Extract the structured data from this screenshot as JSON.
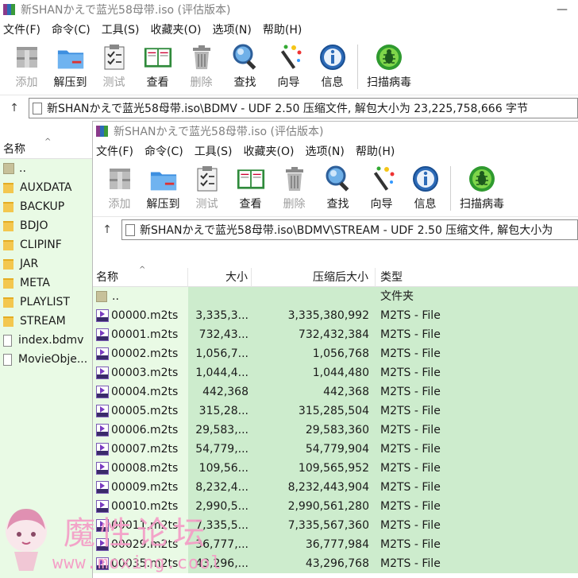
{
  "window1": {
    "title": "新SHANかえで蓝光58母带.iso (评估版本)",
    "menu": [
      "文件(F)",
      "命令(C)",
      "工具(S)",
      "收藏夹(O)",
      "选项(N)",
      "帮助(H)"
    ],
    "toolbar": {
      "add": "添加",
      "extract": "解压到",
      "test": "测试",
      "view": "查看",
      "delete": "删除",
      "find": "查找",
      "wizard": "向导",
      "info": "信息",
      "scan": "扫描病毒"
    },
    "address": "新SHANかえで蓝光58母带.iso\\BDMV - UDF 2.50 压缩文件, 解包大小为 23,225,758,666 字节",
    "column_name": "名称",
    "items": [
      {
        "name": "..",
        "kind": "parent"
      },
      {
        "name": "AUXDATA",
        "kind": "folder"
      },
      {
        "name": "BACKUP",
        "kind": "folder"
      },
      {
        "name": "BDJO",
        "kind": "folder"
      },
      {
        "name": "CLIPINF",
        "kind": "folder"
      },
      {
        "name": "JAR",
        "kind": "folder"
      },
      {
        "name": "META",
        "kind": "folder"
      },
      {
        "name": "PLAYLIST",
        "kind": "folder"
      },
      {
        "name": "STREAM",
        "kind": "folder"
      },
      {
        "name": "index.bdmv",
        "kind": "file"
      },
      {
        "name": "MovieObje...",
        "kind": "file"
      }
    ]
  },
  "window2": {
    "title": "新SHANかえで蓝光58母带.iso (评估版本)",
    "menu": [
      "文件(F)",
      "命令(C)",
      "工具(S)",
      "收藏夹(O)",
      "选项(N)",
      "帮助(H)"
    ],
    "toolbar": {
      "add": "添加",
      "extract": "解压到",
      "test": "测试",
      "view": "查看",
      "delete": "删除",
      "find": "查找",
      "wizard": "向导",
      "info": "信息",
      "scan": "扫描病毒"
    },
    "address": "新SHANかえで蓝光58母带.iso\\BDMV\\STREAM - UDF 2.50 压缩文件, 解包大小为",
    "columns": {
      "name": "名称",
      "size": "大小",
      "packed": "压缩后大小",
      "type": "类型"
    },
    "parent": {
      "name": "..",
      "type": "文件夹"
    },
    "rows": [
      {
        "name": "00000.m2ts",
        "size": "3,335,3...",
        "packed": "3,335,380,992",
        "type": "M2TS - File"
      },
      {
        "name": "00001.m2ts",
        "size": "732,43...",
        "packed": "732,432,384",
        "type": "M2TS - File"
      },
      {
        "name": "00002.m2ts",
        "size": "1,056,7...",
        "packed": "1,056,768",
        "type": "M2TS - File"
      },
      {
        "name": "00003.m2ts",
        "size": "1,044,4...",
        "packed": "1,044,480",
        "type": "M2TS - File"
      },
      {
        "name": "00004.m2ts",
        "size": "442,368",
        "packed": "442,368",
        "type": "M2TS - File"
      },
      {
        "name": "00005.m2ts",
        "size": "315,28...",
        "packed": "315,285,504",
        "type": "M2TS - File"
      },
      {
        "name": "00006.m2ts",
        "size": "29,583,...",
        "packed": "29,583,360",
        "type": "M2TS - File"
      },
      {
        "name": "00007.m2ts",
        "size": "54,779,...",
        "packed": "54,779,904",
        "type": "M2TS - File"
      },
      {
        "name": "00008.m2ts",
        "size": "109,56...",
        "packed": "109,565,952",
        "type": "M2TS - File"
      },
      {
        "name": "00009.m2ts",
        "size": "8,232,4...",
        "packed": "8,232,443,904",
        "type": "M2TS - File"
      },
      {
        "name": "00010.m2ts",
        "size": "2,990,5...",
        "packed": "2,990,561,280",
        "type": "M2TS - File"
      },
      {
        "name": "00011.m2ts",
        "size": "7,335,5...",
        "packed": "7,335,567,360",
        "type": "M2TS - File"
      },
      {
        "name": "00029.m2ts",
        "size": "36,777,...",
        "packed": "36,777,984",
        "type": "M2TS - File"
      },
      {
        "name": "00035.m2ts",
        "size": "43,296,...",
        "packed": "43,296,768",
        "type": "M2TS - File"
      }
    ]
  },
  "watermark": {
    "title": "魔性论坛",
    "url": "www.moxing.cool"
  },
  "colors": {
    "list_bg_light": "#e9fae5",
    "list_bg": "#cdeccd",
    "watermark": "#f59bc6"
  }
}
